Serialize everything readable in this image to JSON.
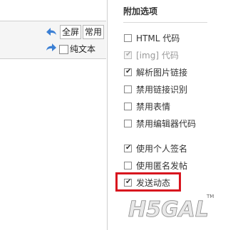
{
  "toolbar": {
    "fullscreen_label": "全屏",
    "common_label": "常用",
    "plaintext_label": "纯文本",
    "undo_icon": "undo-arrow-icon",
    "redo_icon": "redo-arrow-icon"
  },
  "options": {
    "title": "附加选项",
    "items": [
      {
        "label": "HTML 代码",
        "checked": false,
        "disabled": false
      },
      {
        "label": "[img] 代码",
        "checked": true,
        "disabled": true
      },
      {
        "label": "解析图片链接",
        "checked": true,
        "disabled": false
      },
      {
        "label": "禁用链接识别",
        "checked": false,
        "disabled": false
      },
      {
        "label": "禁用表情",
        "checked": false,
        "disabled": false
      },
      {
        "label": "禁用编辑器代码",
        "checked": false,
        "disabled": false
      },
      {
        "label": "使用个人签名",
        "checked": true,
        "disabled": false
      },
      {
        "label": "使用匿名发帖",
        "checked": false,
        "disabled": false
      },
      {
        "label": "发送动态",
        "checked": true,
        "disabled": false
      }
    ]
  },
  "watermark": {
    "text": "H5GAL",
    "tm": "TM"
  },
  "colors": {
    "highlight": "#d8141e",
    "arrow": "#3b7fd4"
  }
}
